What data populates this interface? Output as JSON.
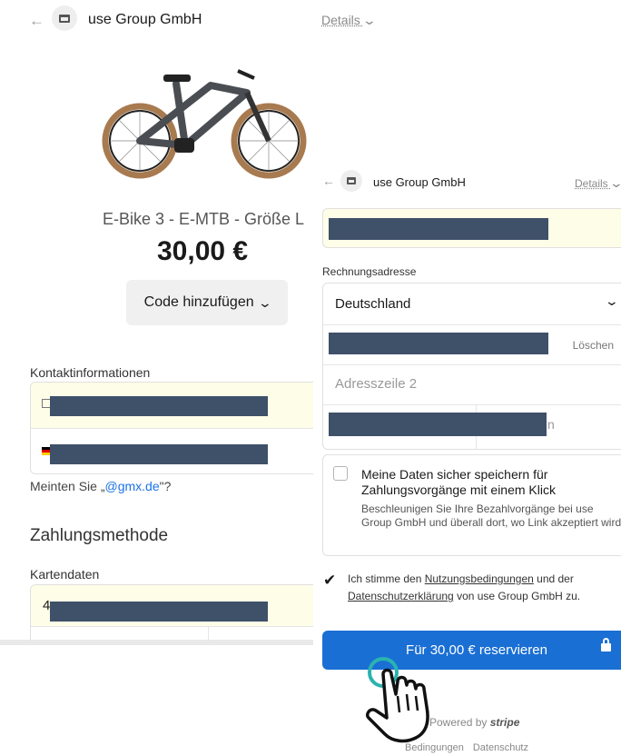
{
  "left": {
    "merchant_name": "use Group GmbH",
    "details_label": "Details",
    "product_name": "E-Bike 3 - E-MTB - Größe L",
    "product_price": "30,00 €",
    "promo_button": "Code hinzufügen",
    "contact_label": "Kontaktinformationen",
    "email_suggestion_prefix": "Meinten Sie „",
    "email_suggestion_link": "@gmx.de",
    "email_suggestion_suffix": "\"?",
    "payment_heading": "Zahlungsmethode",
    "card_label": "Kartendaten",
    "card_number_start": "4"
  },
  "right": {
    "merchant_name": "use Group GmbH",
    "details_label": "Details",
    "billing_label": "Rechnungsadresse",
    "country_value": "Deutschland",
    "delete_label": "Löschen",
    "address_line2_placeholder": "Adresszeile 2",
    "city_tail": "n",
    "save_title": "Meine Daten sicher speichern für Zahlungsvorgänge mit einem Klick",
    "save_description": "Beschleunigen Sie Ihre Bezahlvorgänge bei use Group GmbH und überall dort, wo Link akzeptiert wird.",
    "terms_prefix": "Ich stimme den ",
    "terms_link1": "Nutzungsbedingungen",
    "terms_middle": " und der ",
    "terms_link2": "Datenschutzerklärung",
    "terms_suffix": " von use Group GmbH zu.",
    "pay_button": "Für 30,00 € reservieren",
    "powered_prefix": "Powered by",
    "powered_brand": "stripe",
    "footer_terms": "Bedingungen",
    "footer_privacy": "Datenschutz"
  },
  "colors": {
    "accent_blue": "#1a6fd4",
    "autofill_yellow": "#fefde8",
    "redaction": "#3f5069"
  },
  "icons": [
    "back-arrow-icon",
    "store-icon",
    "chevron-down-icon",
    "envelope-icon",
    "flag-de-icon",
    "lock-icon",
    "hand-pointer-icon"
  ]
}
